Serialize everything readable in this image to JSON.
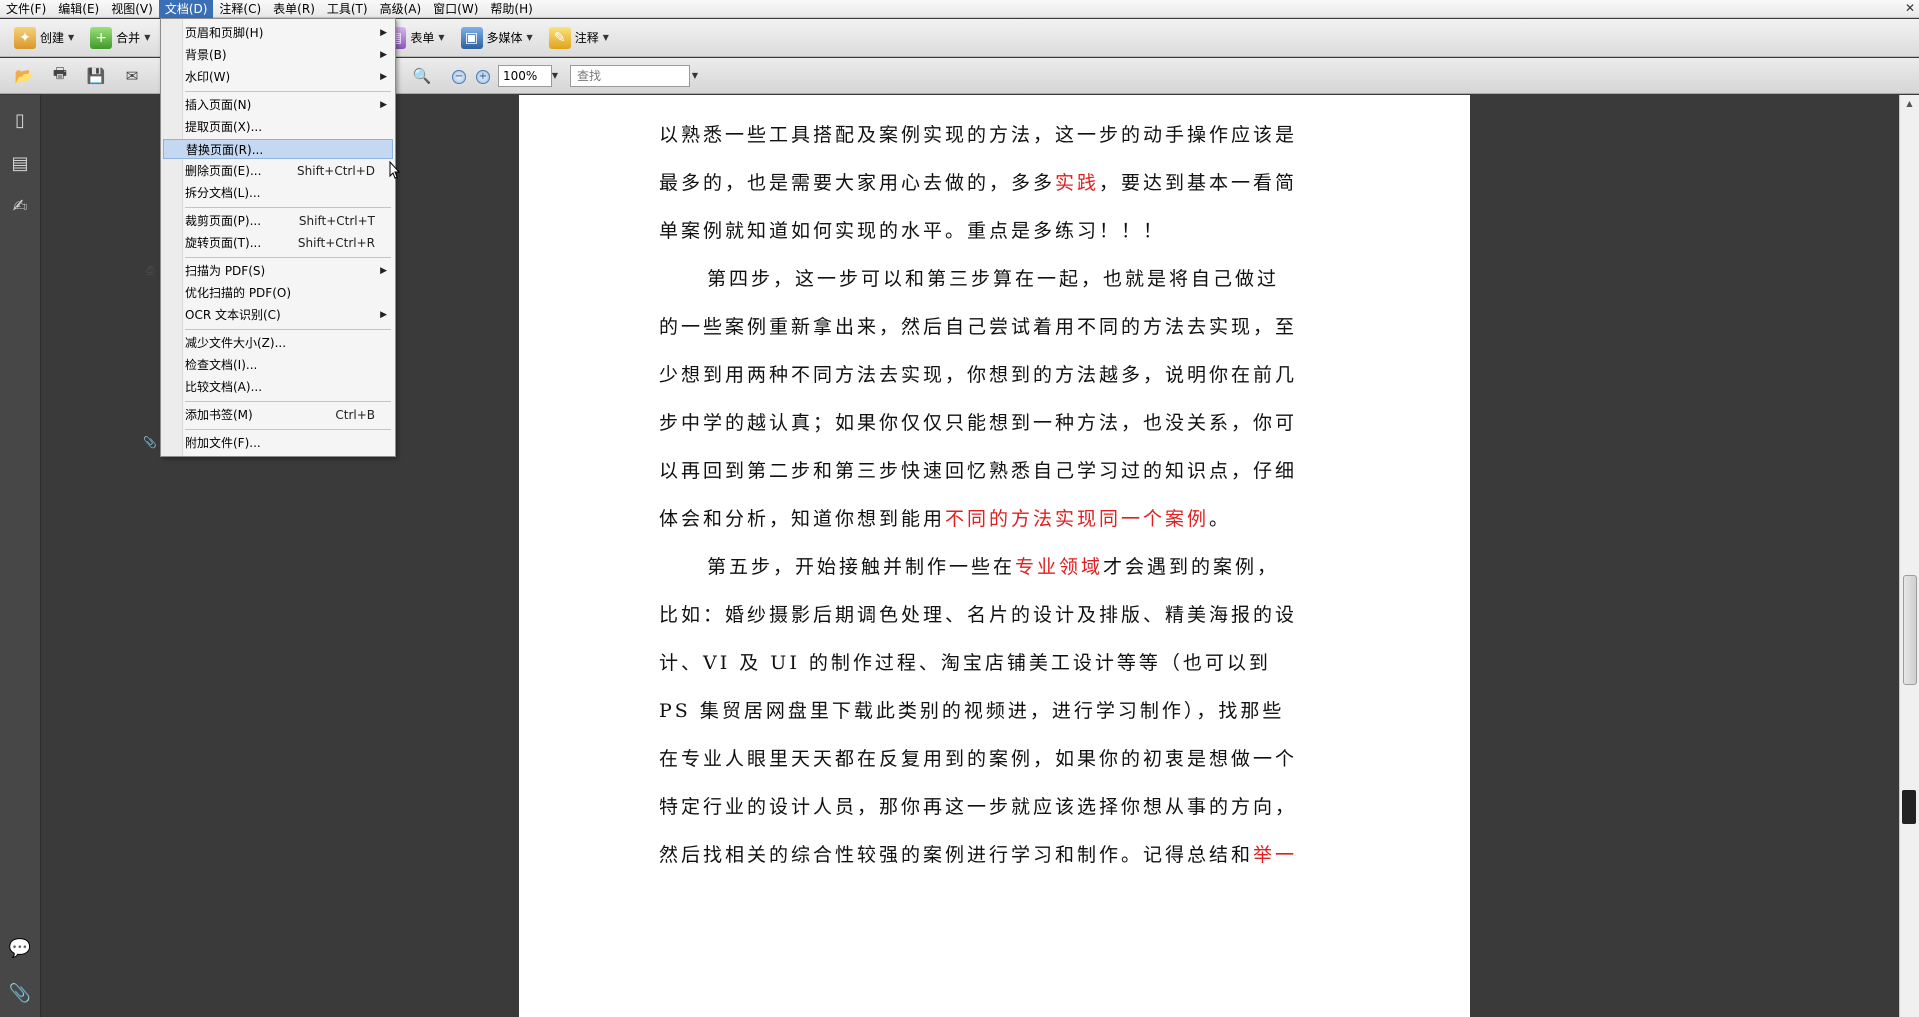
{
  "menubar": {
    "items": [
      "文件(F)",
      "编辑(E)",
      "视图(V)",
      "文档(D)",
      "注释(C)",
      "表单(R)",
      "工具(T)",
      "高级(A)",
      "窗口(W)",
      "帮助(H)"
    ],
    "active_index": 3
  },
  "toolbar1": {
    "create_label": "创建",
    "combine_label": "合并",
    "forms_label": "表单",
    "multimedia_label": "多媒体",
    "comment_label": "注释"
  },
  "toolbar2": {
    "zoom_value": "100%",
    "find_placeholder": "查找"
  },
  "document_menu": {
    "items": [
      {
        "label": "页眉和页脚(H)",
        "shortcut": "",
        "submenu": true
      },
      {
        "label": "背景(B)",
        "shortcut": "",
        "submenu": true
      },
      {
        "label": "水印(W)",
        "shortcut": "",
        "submenu": true
      },
      {
        "label": "插入页面(N)",
        "shortcut": "",
        "submenu": true
      },
      {
        "label": "提取页面(X)...",
        "shortcut": "",
        "submenu": false
      },
      {
        "label": "替换页面(R)...",
        "shortcut": "",
        "submenu": false
      },
      {
        "label": "删除页面(E)...",
        "shortcut": "Shift+Ctrl+D",
        "submenu": false
      },
      {
        "label": "拆分文档(L)...",
        "shortcut": "",
        "submenu": false
      },
      {
        "label": "裁剪页面(P)...",
        "shortcut": "Shift+Ctrl+T",
        "submenu": false
      },
      {
        "label": "旋转页面(T)...",
        "shortcut": "Shift+Ctrl+R",
        "submenu": false
      },
      {
        "label": "扫描为 PDF(S)",
        "shortcut": "",
        "submenu": true
      },
      {
        "label": "优化扫描的 PDF(O)",
        "shortcut": "",
        "submenu": false
      },
      {
        "label": "OCR 文本识别(C)",
        "shortcut": "",
        "submenu": true
      },
      {
        "label": "减少文件大小(Z)...",
        "shortcut": "",
        "submenu": false
      },
      {
        "label": "检查文档(I)...",
        "shortcut": "",
        "submenu": false
      },
      {
        "label": "比较文档(A)...",
        "shortcut": "",
        "submenu": false
      },
      {
        "label": "添加书签(M)",
        "shortcut": "Ctrl+B",
        "submenu": false
      },
      {
        "label": "附加文件(F)...",
        "shortcut": "",
        "submenu": false
      }
    ],
    "highlighted_index": 5
  },
  "document": {
    "p1": "以熟悉一些工具搭配及案例实现的方法，这一步的动手操作应该是最多的，也是需要大家用心去做的，多多",
    "p1_red": "实践",
    "p1_end": "，要达到基本一看简单案例就知道如何实现的水平。重点是多练习！！！",
    "p2": "第四步，这一步可以和第三步算在一起，也就是将自己做过的一些案例重新拿出来，然后自己尝试着用不同的方法去实现，至少想到用两种不同方法去实现，你想到的方法越多，说明你在前几步中学的越认真；如果你仅仅只能想到一种方法，也没关系，你可以再回到第二步和第三步快速回忆熟悉自己学习过的知识点，仔细体会和分析，知道你想到能用",
    "p2_red": "不同的方法实现同一个案例",
    "p2_end": "。",
    "p3_start": "第五步，开始接触并制作一些在",
    "p3_red": "专业领域",
    "p3_mid": "才会遇到的案例，比如：婚纱摄影后期调色处理、名片的设计及排版、精美海报的设计、VI 及 UI 的制作过程、淘宝店铺美工设计等等（也可以到 PS 集贸居网盘里下载此类别的视频进，进行学习制作），找那些在专业人眼里天天都在反复用到的案例，如果你的初衷是想做一个特定行业的设计人员，那你再这一步就应该选择你想从事的方向，然后找相关的综合性较强的案例进行学习和制作。记得总结和",
    "p3_red2": "举一"
  }
}
